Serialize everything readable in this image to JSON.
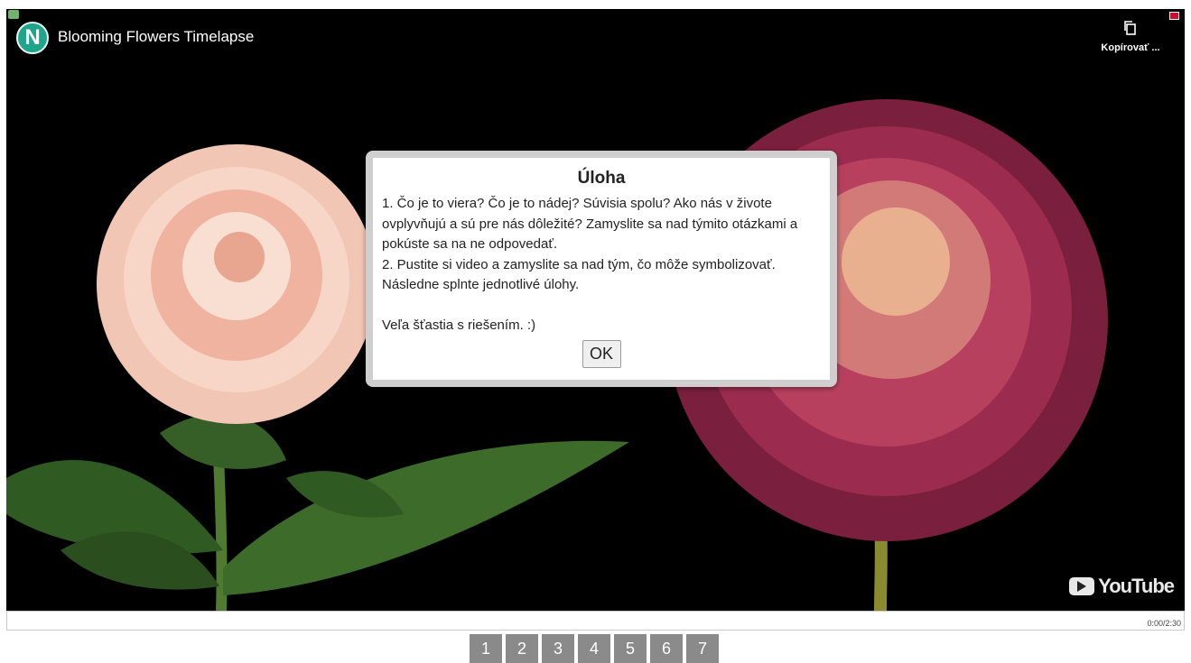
{
  "video": {
    "title": "Blooming Flowers Timelapse",
    "channel_logo_letter": "N",
    "copy_label": "Kopírovať ...",
    "youtube_label": "YouTube",
    "time": "0:00/2:30"
  },
  "dialog": {
    "title": "Úloha",
    "body": "1. Čo je to viera? Čo je to nádej? Súvisia spolu? Ako nás v živote ovplyvňujú a sú pre nás dôležité? Zamyslite sa nad týmito otázkami a pokúste sa na ne odpovedať.\n2. Pustite si video a zamyslite sa nad tým, čo môže symbolizovať. Následne splnte jednotlivé úlohy.\n\nVeľa šťastia s riešením. :)",
    "ok_label": "OK"
  },
  "pager": [
    "1",
    "2",
    "3",
    "4",
    "5",
    "6",
    "7"
  ],
  "colors": {
    "logo": "#1fa58a",
    "page_button": "#8a8a8a"
  }
}
